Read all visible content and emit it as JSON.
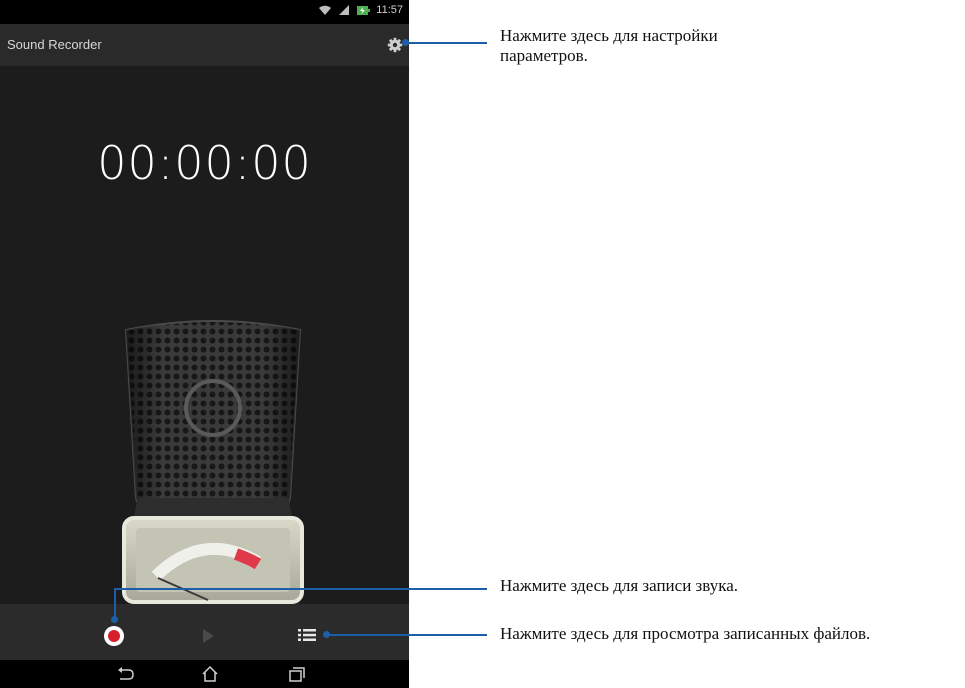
{
  "status_bar": {
    "time": "11:57",
    "icons": [
      "wifi-icon",
      "signal-icon",
      "battery-charging-icon"
    ]
  },
  "app_bar": {
    "title": "Sound Recorder",
    "settings_icon": "gear-icon"
  },
  "recorder": {
    "timer": "00:00:00",
    "level_meter_value": 0.0
  },
  "controls": {
    "record_icon": "record-icon",
    "play_icon": "play-icon",
    "list_icon": "list-icon"
  },
  "nav_bar": {
    "buttons": [
      "back-icon",
      "home-icon",
      "recent-apps-icon"
    ]
  },
  "callouts": {
    "settings": "Нажмите здесь для настройки параметров.",
    "record": "Нажмите здесь для записи звука.",
    "files": "Нажмите здесь для просмотра записанных файлов."
  },
  "colors": {
    "accent": "#1b5fa8",
    "record_red": "#d61f2a",
    "meter_red": "#e0394a"
  }
}
